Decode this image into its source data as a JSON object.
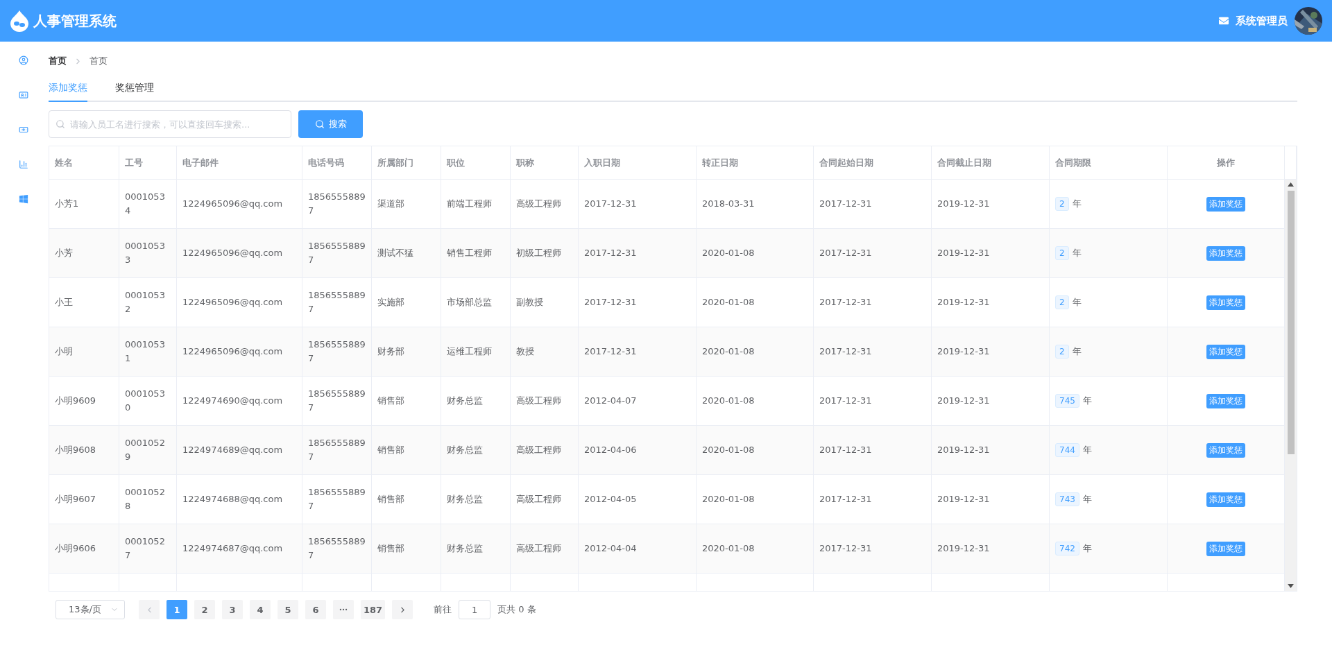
{
  "header": {
    "title": "人事管理系统",
    "user": "系统管理员"
  },
  "breadcrumb": [
    "首页",
    "首页"
  ],
  "tabs": [
    {
      "label": "添加奖惩",
      "selected": true
    },
    {
      "label": "奖惩管理",
      "selected": false
    }
  ],
  "search": {
    "placeholder": "请输入员工名进行搜索，可以直接回车搜索...",
    "button": "搜索"
  },
  "table": {
    "columns": [
      "姓名",
      "工号",
      "电子邮件",
      "电话号码",
      "所属部门",
      "职位",
      "职称",
      "入职日期",
      "转正日期",
      "合同起始日期",
      "合同截止日期",
      "合同期限",
      "操作"
    ],
    "rows": [
      {
        "name": "小芳1",
        "id": "00010534",
        "email": "1224965096@qq.com",
        "phone": "18565558897",
        "dept": "渠道部",
        "position": "前端工程师",
        "title": "高级工程师",
        "hired": "2017-12-31",
        "regular": "2018-03-31",
        "start": "2017-12-31",
        "end": "2019-12-31",
        "term": "2",
        "unit": "年",
        "action": "添加奖惩"
      },
      {
        "name": "小芳",
        "id": "00010533",
        "email": "1224965096@qq.com",
        "phone": "18565558897",
        "dept": "测试不猛",
        "position": "销售工程师",
        "title": "初级工程师",
        "hired": "2017-12-31",
        "regular": "2020-01-08",
        "start": "2017-12-31",
        "end": "2019-12-31",
        "term": "2",
        "unit": "年",
        "action": "添加奖惩"
      },
      {
        "name": "小王",
        "id": "00010532",
        "email": "1224965096@qq.com",
        "phone": "18565558897",
        "dept": "实施部",
        "position": "市场部总监",
        "title": "副教授",
        "hired": "2017-12-31",
        "regular": "2020-01-08",
        "start": "2017-12-31",
        "end": "2019-12-31",
        "term": "2",
        "unit": "年",
        "action": "添加奖惩"
      },
      {
        "name": "小明",
        "id": "00010531",
        "email": "1224965096@qq.com",
        "phone": "18565558897",
        "dept": "财务部",
        "position": "运维工程师",
        "title": "教授",
        "hired": "2017-12-31",
        "regular": "2020-01-08",
        "start": "2017-12-31",
        "end": "2019-12-31",
        "term": "2",
        "unit": "年",
        "action": "添加奖惩"
      },
      {
        "name": "小明9609",
        "id": "00010530",
        "email": "1224974690@qq.com",
        "phone": "18565558897",
        "dept": "销售部",
        "position": "财务总监",
        "title": "高级工程师",
        "hired": "2012-04-07",
        "regular": "2020-01-08",
        "start": "2017-12-31",
        "end": "2019-12-31",
        "term": "745",
        "unit": "年",
        "action": "添加奖惩"
      },
      {
        "name": "小明9608",
        "id": "00010529",
        "email": "1224974689@qq.com",
        "phone": "18565558897",
        "dept": "销售部",
        "position": "财务总监",
        "title": "高级工程师",
        "hired": "2012-04-06",
        "regular": "2020-01-08",
        "start": "2017-12-31",
        "end": "2019-12-31",
        "term": "744",
        "unit": "年",
        "action": "添加奖惩"
      },
      {
        "name": "小明9607",
        "id": "00010528",
        "email": "1224974688@qq.com",
        "phone": "18565558897",
        "dept": "销售部",
        "position": "财务总监",
        "title": "高级工程师",
        "hired": "2012-04-05",
        "regular": "2020-01-08",
        "start": "2017-12-31",
        "end": "2019-12-31",
        "term": "743",
        "unit": "年",
        "action": "添加奖惩"
      },
      {
        "name": "小明9606",
        "id": "00010527",
        "email": "1224974687@qq.com",
        "phone": "18565558897",
        "dept": "销售部",
        "position": "财务总监",
        "title": "高级工程师",
        "hired": "2012-04-04",
        "regular": "2020-01-08",
        "start": "2017-12-31",
        "end": "2019-12-31",
        "term": "742",
        "unit": "年",
        "action": "添加奖惩"
      }
    ]
  },
  "pagination": {
    "page_size": "13条/页",
    "pages": [
      {
        "label": "1",
        "selected": true
      },
      {
        "label": "2",
        "selected": false
      },
      {
        "label": "3",
        "selected": false
      },
      {
        "label": "4",
        "selected": false
      },
      {
        "label": "5",
        "selected": false
      },
      {
        "label": "6",
        "selected": false
      },
      {
        "kind": "more"
      },
      {
        "label": "187",
        "selected": false
      }
    ],
    "goto_label": "前往",
    "goto_value": "1",
    "total": "页共 0 条"
  }
}
